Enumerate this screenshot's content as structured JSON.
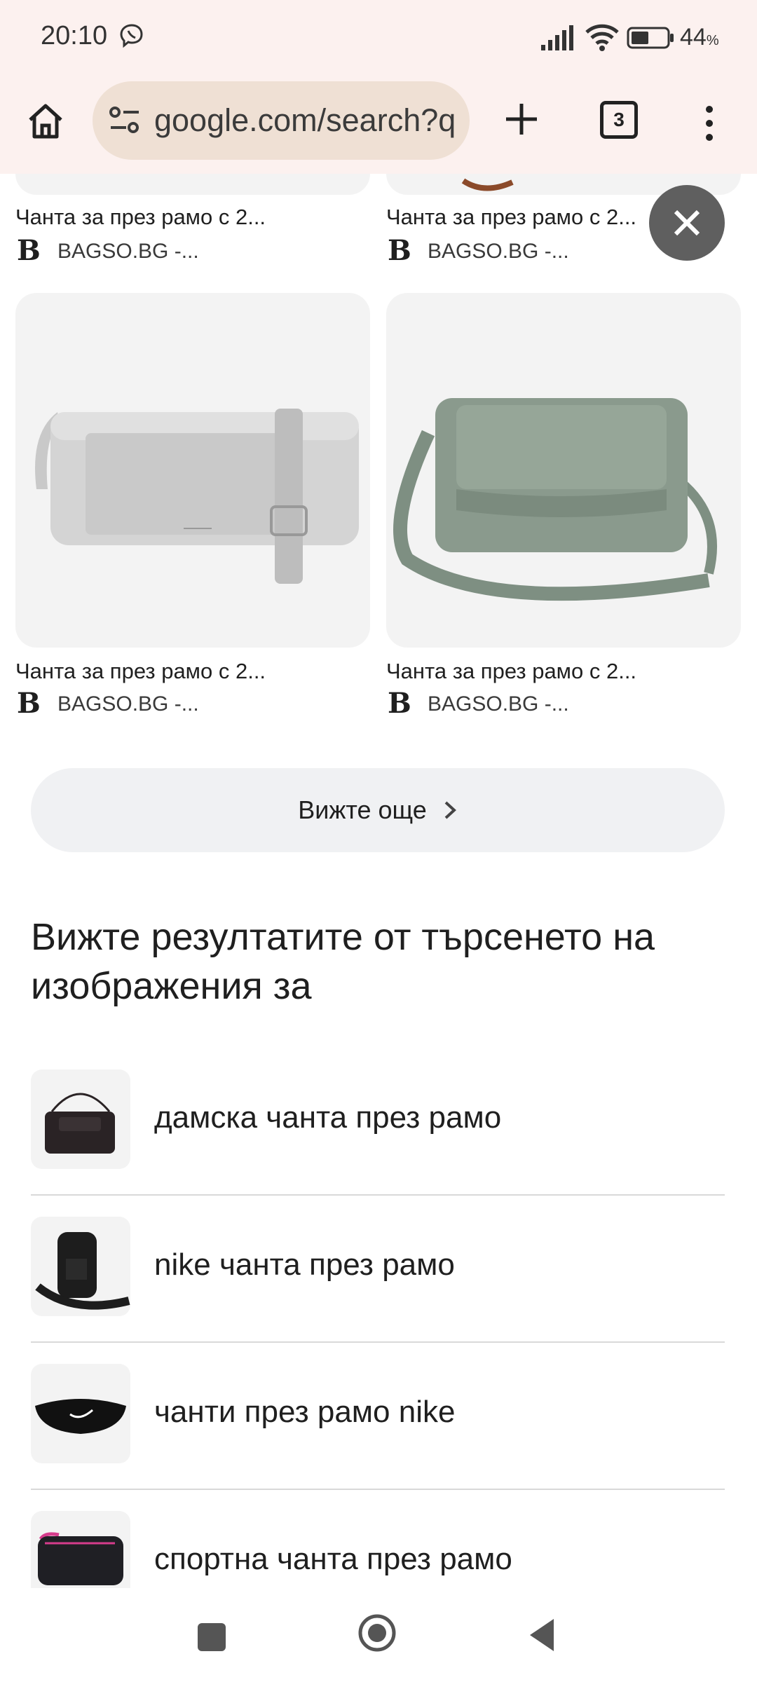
{
  "status_bar": {
    "time": "20:10",
    "battery_percent": "44",
    "battery_unit": "%"
  },
  "browser": {
    "url": "google.com/search?q",
    "tab_count": "3"
  },
  "products": [
    {
      "title": "Чанта за през рамо с 2...",
      "source": "BAGSO.BG -..."
    },
    {
      "title": "Чанта за през рамо с 2...",
      "source": "BAGSO.BG -..."
    },
    {
      "title": "Чанта за през рамо с 2...",
      "source": "BAGSO.BG -...",
      "color": "#c9c9c9"
    },
    {
      "title": "Чанта за през рамо с 2...",
      "source": "BAGSO.BG -...",
      "color": "#8a9a8d"
    }
  ],
  "source_logo_letter": "B",
  "see_more_label": "Вижте още",
  "section_heading": "Вижте резултатите от търсенето на изображения за",
  "related_searches": [
    {
      "label": "дамска чанта през рамо",
      "icon": "black-chain-shoulder-bag"
    },
    {
      "label": "nike чанта през рамо",
      "icon": "nike-crossbody-bag"
    },
    {
      "label": "чанти през рамо nike",
      "icon": "nike-waist-bag"
    },
    {
      "label": "спортна чанта през рамо",
      "icon": "pink-black-sport-bag"
    }
  ],
  "colors": {
    "chrome_background": "#fcf1ef",
    "url_bar": "#efe0d4",
    "card_background": "#f3f3f3",
    "fab": "#5f5f5f"
  }
}
